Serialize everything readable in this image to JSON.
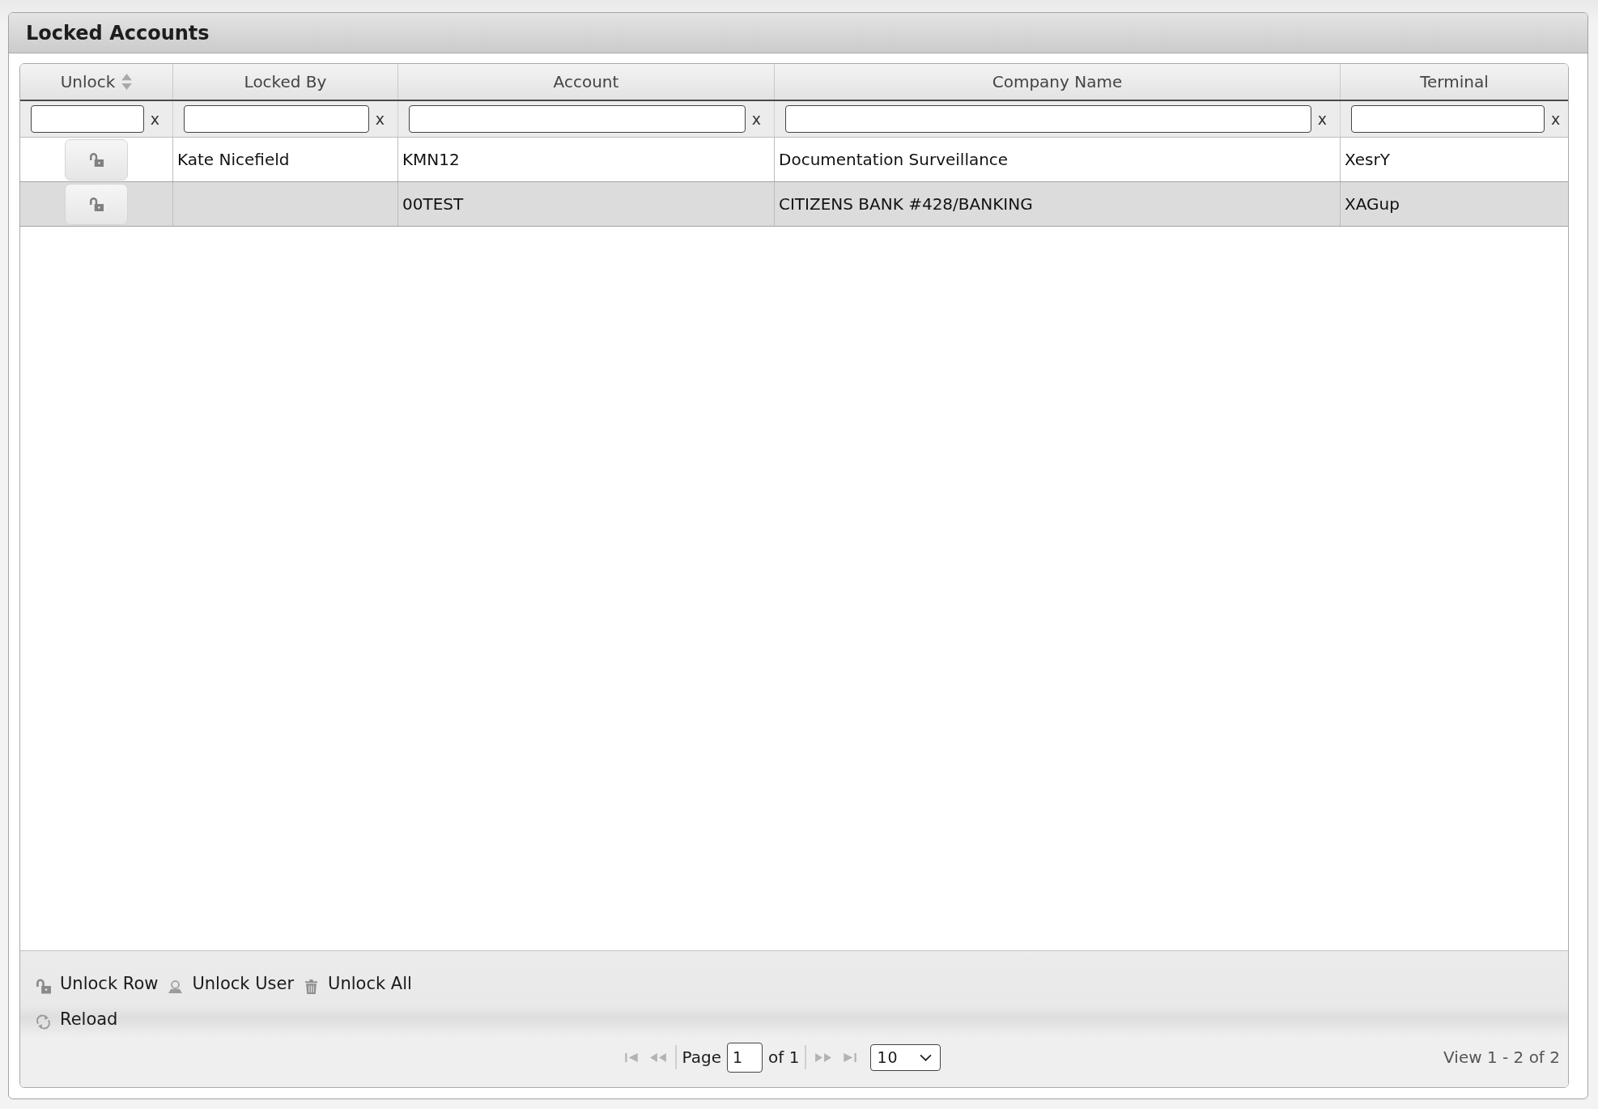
{
  "panel": {
    "title": "Locked Accounts"
  },
  "grid": {
    "columns": [
      {
        "label": "Unlock",
        "sortable": true,
        "clear": "x"
      },
      {
        "label": "Locked By",
        "sortable": false,
        "clear": "x"
      },
      {
        "label": "Account",
        "sortable": false,
        "clear": "x"
      },
      {
        "label": "Company Name",
        "sortable": false,
        "clear": "x"
      },
      {
        "label": "Terminal",
        "sortable": false,
        "clear": "x"
      }
    ],
    "rows": [
      {
        "selected": false,
        "locked_by": "Kate Nicefield",
        "account": "KMN12",
        "company_name": "Documentation Surveillance",
        "terminal": "XesrY"
      },
      {
        "selected": true,
        "account": "00TEST",
        "company_name": "CITIZENS BANK #428/BANKING",
        "terminal": "XAGup"
      }
    ]
  },
  "toolbar": {
    "buttons": [
      {
        "kind": "unlock",
        "label": "Unlock Row"
      },
      {
        "kind": "user",
        "label": "Unlock User"
      },
      {
        "kind": "trash",
        "label": "Unlock All"
      },
      {
        "kind": "reload",
        "label": "Reload"
      }
    ]
  },
  "pager": {
    "nav_left": [
      {
        "kind": "first",
        "disabled": true
      },
      {
        "kind": "prev",
        "disabled": true
      }
    ],
    "page_label": "Page",
    "page_value": "1",
    "page_total": "of 1",
    "nav_right": [
      {
        "kind": "next",
        "disabled": true
      },
      {
        "kind": "last",
        "disabled": true
      }
    ],
    "page_size": "10",
    "view_text": "View 1 - 2 of 2"
  }
}
